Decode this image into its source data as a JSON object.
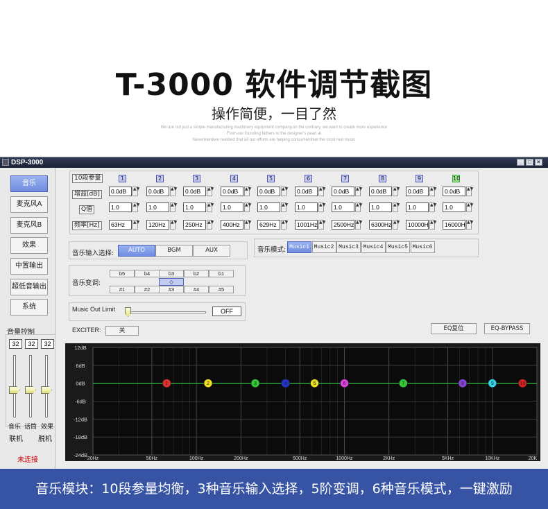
{
  "hero": {
    "title": "T-3000 软件调节截图",
    "subtitle": "操作简便，一目了然",
    "fine_lines": [
      "We are not just a simple manufacturing machinery equipment company,on the contrary, we want to create more experience",
      "From our founding fathers to the designer's pearl at",
      "Nevermentiwe realized that all our efforts are helping consumersfeel the most real music"
    ]
  },
  "window": {
    "title": "DSP-3000",
    "controls": [
      "_",
      "□",
      "×"
    ]
  },
  "sidebar": {
    "items": [
      {
        "label": "音乐",
        "active": true
      },
      {
        "label": "麦克风A",
        "active": false
      },
      {
        "label": "麦克风B",
        "active": false
      },
      {
        "label": "效果",
        "active": false
      },
      {
        "label": "中置输出",
        "active": false
      },
      {
        "label": "超低音输出",
        "active": false
      },
      {
        "label": "系统",
        "active": false
      }
    ],
    "volume": {
      "label": "音量控制",
      "channels": [
        {
          "value": "32",
          "caption": "音乐"
        },
        {
          "value": "32",
          "caption": "话筒"
        },
        {
          "value": "32",
          "caption": "效果"
        }
      ]
    },
    "connect_label": "联机",
    "disconnect_label": "脱机",
    "status": "未连接"
  },
  "eq_table": {
    "header_label": "10段参量",
    "gain_label": "增益[dB]",
    "q_label": "Q值",
    "freq_label": "频率[Hz]",
    "bands": [
      {
        "num": "1",
        "gain": "0.0dB",
        "q": "1.0",
        "freq": "63Hz"
      },
      {
        "num": "2",
        "gain": "0.0dB",
        "q": "1.0",
        "freq": "120Hz"
      },
      {
        "num": "3",
        "gain": "0.0dB",
        "q": "1.0",
        "freq": "250Hz"
      },
      {
        "num": "4",
        "gain": "0.0dB",
        "q": "1.0",
        "freq": "400Hz"
      },
      {
        "num": "5",
        "gain": "0.0dB",
        "q": "1.0",
        "freq": "629Hz"
      },
      {
        "num": "6",
        "gain": "0.0dB",
        "q": "1.0",
        "freq": "1001Hz"
      },
      {
        "num": "7",
        "gain": "0.0dB",
        "q": "1.0",
        "freq": "2500Hz"
      },
      {
        "num": "8",
        "gain": "0.0dB",
        "q": "1.0",
        "freq": "6300Hz"
      },
      {
        "num": "9",
        "gain": "0.0dB",
        "q": "1.0",
        "freq": "10000H"
      },
      {
        "num": "10",
        "gain": "0.0dB",
        "q": "1.0",
        "freq": "16000H"
      }
    ]
  },
  "input_select": {
    "label": "音乐输入选择:",
    "options": [
      "AUTO",
      "BGM",
      "AUX"
    ],
    "selected": "AUTO"
  },
  "music_mode": {
    "label": "音乐模式:",
    "options": [
      "Music1",
      "Music2",
      "Music3",
      "Music4",
      "Music5",
      "Music6"
    ],
    "selected": "Music1"
  },
  "transpose": {
    "label": "音乐变调:",
    "flats": [
      "b5",
      "b4",
      "b3",
      "b2",
      "b1"
    ],
    "sharps": [
      "#1",
      "#2",
      "#3",
      "#4",
      "#5"
    ],
    "center_symbol": "◇"
  },
  "music_out": {
    "label": "Music Out Limit",
    "value": "OFF",
    "level": 0
  },
  "exciter": {
    "label": "EXCITER:",
    "value": "关"
  },
  "buttons": {
    "eq_reset": "EQ复位",
    "eq_bypass": "EQ-BYPASS"
  },
  "colors": {
    "accent": "#6f8ce0",
    "banner": "#3753a3",
    "curve": "#35d04a",
    "chart_bg": "#0b0b0b",
    "band_colors": [
      "#e23030",
      "#f2e020",
      "#35c93a",
      "#2233cc",
      "#e8e020",
      "#e040e0",
      "#35c93a",
      "#8844dd",
      "#30d8e8",
      "#e02020"
    ]
  },
  "chart_data": {
    "type": "line",
    "x_scale": "log",
    "x_ticks": [
      "20Hz",
      "50Hz",
      "100Hz",
      "200Hz",
      "500Hz",
      "1000Hz",
      "2KHz",
      "5KHz",
      "10KHz",
      "20K"
    ],
    "x_tick_values": [
      20,
      50,
      100,
      200,
      500,
      1000,
      2000,
      5000,
      10000,
      20000
    ],
    "y_ticks": [
      "12dB",
      "6dB",
      "0dB",
      "-6dB",
      "-12dB",
      "-18dB",
      "-24dB"
    ],
    "y_tick_values": [
      12,
      6,
      0,
      -6,
      -12,
      -18,
      -24
    ],
    "ylim": [
      -24,
      12
    ],
    "xlim": [
      20,
      20000
    ],
    "grid": true,
    "points": [
      {
        "label": "1",
        "freq": 63,
        "gain": 0
      },
      {
        "label": "2",
        "freq": 120,
        "gain": 0
      },
      {
        "label": "3",
        "freq": 250,
        "gain": 0
      },
      {
        "label": "4",
        "freq": 400,
        "gain": 0
      },
      {
        "label": "5",
        "freq": 629,
        "gain": 0
      },
      {
        "label": "6",
        "freq": 1001,
        "gain": 0
      },
      {
        "label": "7",
        "freq": 2500,
        "gain": 0
      },
      {
        "label": "8",
        "freq": 6300,
        "gain": 0
      },
      {
        "label": "9",
        "freq": 10000,
        "gain": 0
      },
      {
        "label": "10",
        "freq": 16000,
        "gain": 0
      }
    ]
  },
  "banner": {
    "text": "音乐模块：10段参量均衡，3种音乐输入选择，5阶变调，6种音乐模式，一键激励"
  }
}
